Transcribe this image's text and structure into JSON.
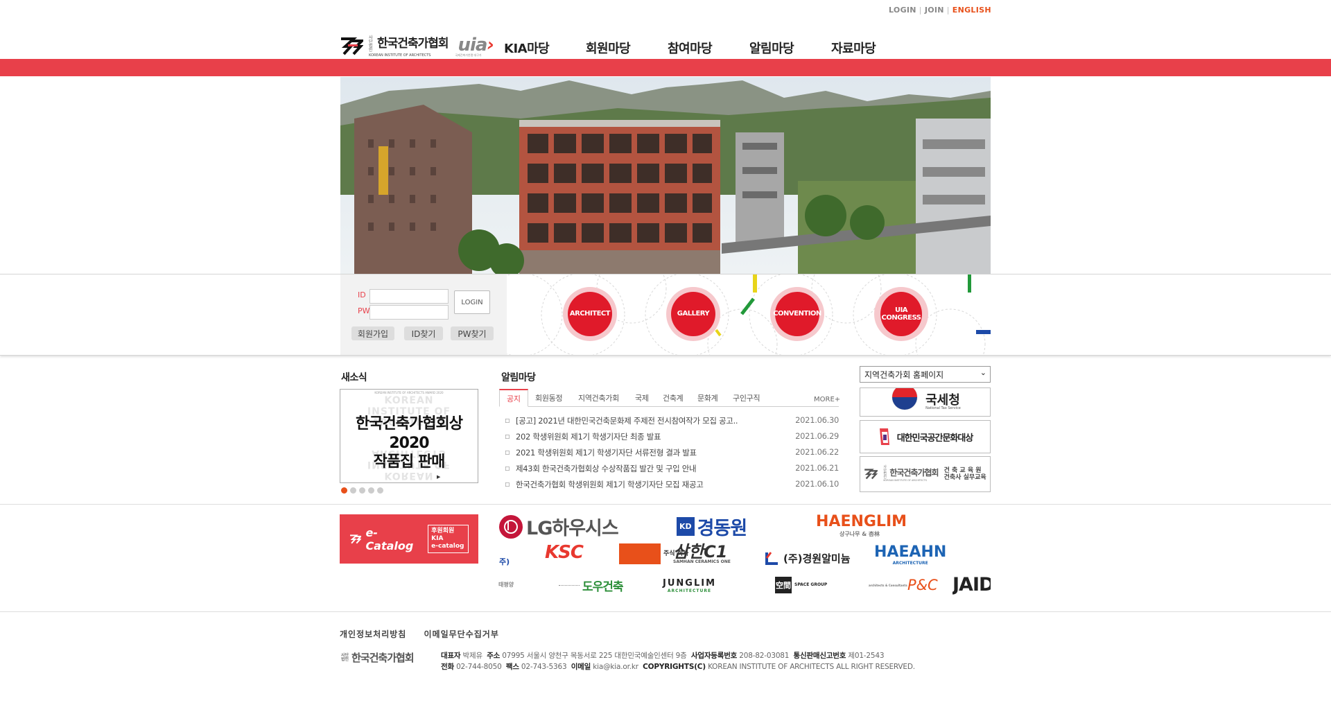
{
  "top_links": {
    "login": "LOGIN",
    "join": "JOIN",
    "english": "ENGLISH"
  },
  "logo": {
    "org_ko": "한국건축가협회",
    "org_prefix": "사단법인",
    "org_en": "KOREAN INSTITUTE OF ARCHITECTS",
    "uia": "uia",
    "uia_sub": "국제건축가연맹 대구가"
  },
  "nav": [
    "KIA마당",
    "회원마당",
    "참여마당",
    "알림마당",
    "자료마당"
  ],
  "login": {
    "id_label": "ID",
    "pw_label": "PW",
    "login_button": "LOGIN",
    "join_button": "회원가입",
    "find_id_button": "ID찾기",
    "find_pw_button": "PW찾기"
  },
  "quick_links": [
    "ARCHITECT",
    "GALLERY",
    "CONVENTION",
    "UIA CONGRESS"
  ],
  "news": {
    "title": "새소식",
    "card_tiny": "KOREAN INSTITUTE OF ARCHITECTS AWARD 2020",
    "card_ghost": [
      "KOREAN",
      "INSTITUTE OF",
      "ARCHITECTS",
      "ARCHITECTS",
      "INSTITUTE OF",
      "KOREAN"
    ],
    "card_line1": "한국건축가협회상 2020",
    "card_line2": "작품집 판매",
    "card_mark": "▶",
    "slides": 5
  },
  "notice": {
    "title": "알림마당",
    "tabs": [
      "공지",
      "회원동정",
      "지역건축가회",
      "국제",
      "건축계",
      "문화계",
      "구인구직"
    ],
    "more": "MORE+",
    "items": [
      {
        "title": "[공고] 2021년 대한민국건축문화제 주제전 전시참여작가 모집 공고..",
        "date": "2021.06.30"
      },
      {
        "title": "202 학생위원회 제1기 학생기자단 최종 발표",
        "date": "2021.06.29"
      },
      {
        "title": "2021 학생위원회 제1기 학생기자단 서류전형 결과 발표",
        "date": "2021.06.22"
      },
      {
        "title": "제43회 한국건축가협회상 수상작품집 발간 및 구입 안내",
        "date": "2021.06.21"
      },
      {
        "title": "한국건축가협회 학생위원회 제1기 학생기자단 모집 재공고",
        "date": "2021.06.10"
      }
    ],
    "bullet": "▫"
  },
  "regional_select": {
    "value": "지역건축가회 홈페이지"
  },
  "side_banners": {
    "nts": {
      "ko": "국세청",
      "en": "National Tax Service"
    },
    "space": {
      "ko": "대한민국공간문화대상"
    },
    "edu": {
      "org": "한국건축가협회",
      "prefix": "사단법인",
      "en": "KOREAN INSTITUTE OF ARCHITECTS",
      "l1": "건 축 교 육 원",
      "l2": "건축사 실무교육"
    }
  },
  "ecatalog": {
    "label": "e-Catalog",
    "box1": "후원회원KIA",
    "box2": "e-catalog"
  },
  "sponsors": {
    "lg": "LG하우시스",
    "kdw": "경동원",
    "kdw_mark": "KD",
    "haenglim": "HAENGLIM",
    "haenglim_sub": "상구나무 & 杏林",
    "ju": "주)",
    "ksc": "KSC",
    "samhan": "삼한C1",
    "samhan_pre": "주식 회사",
    "samhan_sub": "SAMHAN CERAMICS ONE",
    "kyungwon": "(주)경원알미늄",
    "haeahn": "HAEAHN",
    "haeahn_sub": "ARCHITECTURE",
    "small1": "태평양",
    "dowoo": "도우건축",
    "junglim": "JUNGLIM",
    "junglim_sub": "ARCHITECTURE",
    "space": "空間",
    "space_sub": "SPACE GROUP",
    "pac": "P&C",
    "pac_sub": "architects & Consultants",
    "jaid": "JAID"
  },
  "footer": {
    "links": [
      "개인정보처리방침",
      "이메일무단수집거부"
    ],
    "logo": "한국건축가협회",
    "logo_prefix": "사단법인",
    "ceo_label": "대표자",
    "ceo": "박제유",
    "addr_label": "주소",
    "addr": "07995 서울시 양천구 목동서로 225 대한민국예술인센터 9층",
    "biz_label": "사업자등록번호",
    "biz": "208-82-03081",
    "mail_order_label": "통신판매신고번호",
    "mail_order": "제01-2543",
    "tel_label": "전화",
    "tel": "02-744-8050",
    "fax_label": "팩스",
    "fax": "02-743-5363",
    "email_label": "이메일",
    "email": "kia@kia.or.kr",
    "copy_label": "COPYRIGHTS(C)",
    "copy": "KOREAN INSTITUTE OF ARCHITECTS ALL RIGHT RESERVED."
  },
  "colors": {
    "brand_red": "#e8404a",
    "accent_orange": "#e8501a"
  }
}
